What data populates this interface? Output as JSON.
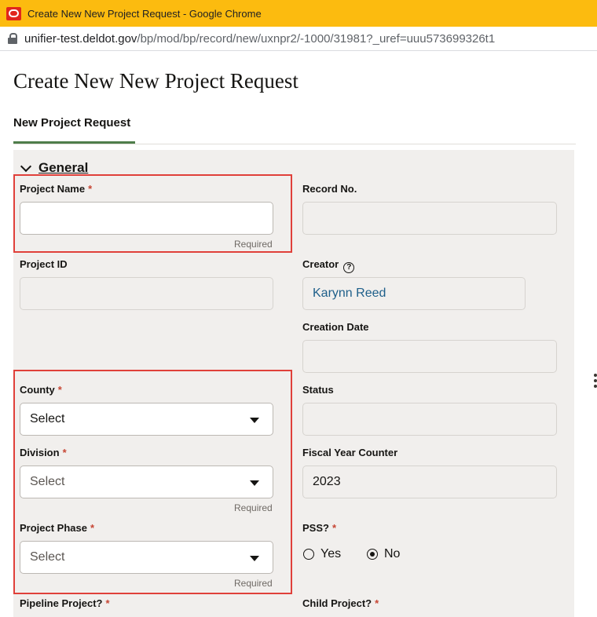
{
  "browser": {
    "title": "Create New New Project Request - Google Chrome",
    "url_host": "unifier-test.deldot.gov",
    "url_path": "/bp/mod/bp/record/new/uxnpr2/-1000/31981?_uref=uuu573699326t1"
  },
  "page": {
    "title": "Create New New Project Request",
    "tab_label": "New Project Request",
    "section_title": "General"
  },
  "fields": {
    "project_name": {
      "label": "Project Name",
      "value": "",
      "hint": "Required"
    },
    "record_no": {
      "label": "Record No.",
      "value": ""
    },
    "project_id": {
      "label": "Project ID",
      "value": ""
    },
    "creator": {
      "label": "Creator",
      "value": "Karynn Reed"
    },
    "creation_date": {
      "label": "Creation Date",
      "value": ""
    },
    "county": {
      "label": "County",
      "value": "Select"
    },
    "status": {
      "label": "Status",
      "value": ""
    },
    "division": {
      "label": "Division",
      "value": "Select",
      "hint": "Required"
    },
    "fiscal_year_counter": {
      "label": "Fiscal Year Counter",
      "value": "2023"
    },
    "project_phase": {
      "label": "Project Phase",
      "value": "Select",
      "hint": "Required"
    },
    "pss": {
      "label": "PSS?",
      "options": [
        "Yes",
        "No"
      ],
      "selected": "No"
    },
    "pipeline_project": {
      "label": "Pipeline Project?"
    },
    "child_project": {
      "label": "Child Project?"
    }
  },
  "required_marker": "*",
  "help_glyph": "?",
  "colors": {
    "titlebar": "#fcbb0f",
    "required": "#c74634",
    "highlight": "#e0403a",
    "tab_underline": "#4e7d4a",
    "link": "#1e5f8a"
  }
}
